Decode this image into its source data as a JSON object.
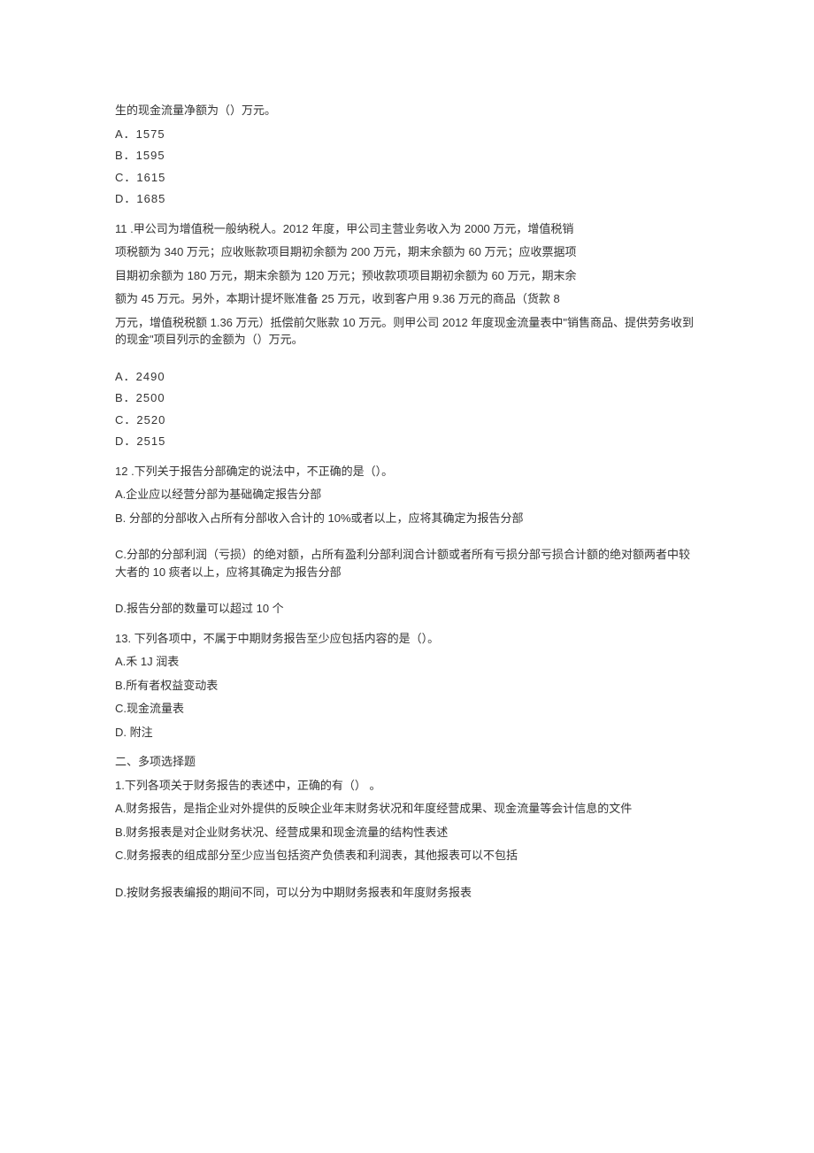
{
  "q10": {
    "stem_tail": "生的现金流量净额为（）万元。",
    "optA": "A．1575",
    "optB": "B．1595",
    "optC": "C．1615",
    "optD": "D．1685"
  },
  "q11": {
    "l1": "11 .甲公司为增值税一般纳税人。2012 年度，甲公司主营业务收入为 2000 万元，增值税销",
    "l2": "项税额为 340 万元；应收账款项目期初余额为 200 万元，期末余额为 60 万元；应收票据项",
    "l3": "目期初余额为 180 万元，期末余额为 120 万元；预收款项项目期初余额为 60 万元，期末余",
    "l4": "额为 45 万元。另外，本期计提坏账准备 25 万元，收到客户用 9.36 万元的商品（货款 8",
    "l5": "万元，增值税税额 1.36 万元）抵偿前欠账款 10 万元。则甲公司 2012 年度现金流量表中\"销售商品、提供劳务收到的现金\"项目列示的金额为（）万元。",
    "optA": "A．2490",
    "optB": "B．2500",
    "optC": "C．2520",
    "optD": "D．2515"
  },
  "q12": {
    "stem": "12 .下列关于报告分部确定的说法中，不正确的是（）。",
    "optA": "A.企业应以经营分部为基础确定报告分部",
    "optB": "B. 分部的分部收入占所有分部收入合计的 10%或者以上，应将其确定为报告分部",
    "optC": "C.分部的分部利润（亏损）的绝对额，占所有盈利分部利润合计额或者所有亏损分部亏损合计额的绝对额两者中较大者的 10 痰者以上，应将其确定为报告分部",
    "optD": "D.报告分部的数量可以超过 10 个"
  },
  "q13": {
    "stem": "13. 下列各项中，不属于中期财务报告至少应包括内容的是（）。",
    "optA": "A.禾 1J 润表",
    "optB": "B.所有者权益变动表",
    "optC": "C.现金流量表",
    "optD": "D. 附注"
  },
  "section2": {
    "title": "二、多项选择题",
    "q1": {
      "stem": "1.下列各项关于财务报告的表述中，正确的有（） 。",
      "optA": "A.财务报告，是指企业对外提供的反映企业年末财务状况和年度经营成果、现金流量等会计信息的文件",
      "optB": "B.财务报表是对企业财务状况、经营成果和现金流量的结构性表述",
      "optC": "C.财务报表的组成部分至少应当包括资产负债表和利润表，其他报表可以不包括",
      "optD": "D.按财务报表编报的期间不同，可以分为中期财务报表和年度财务报表"
    }
  }
}
